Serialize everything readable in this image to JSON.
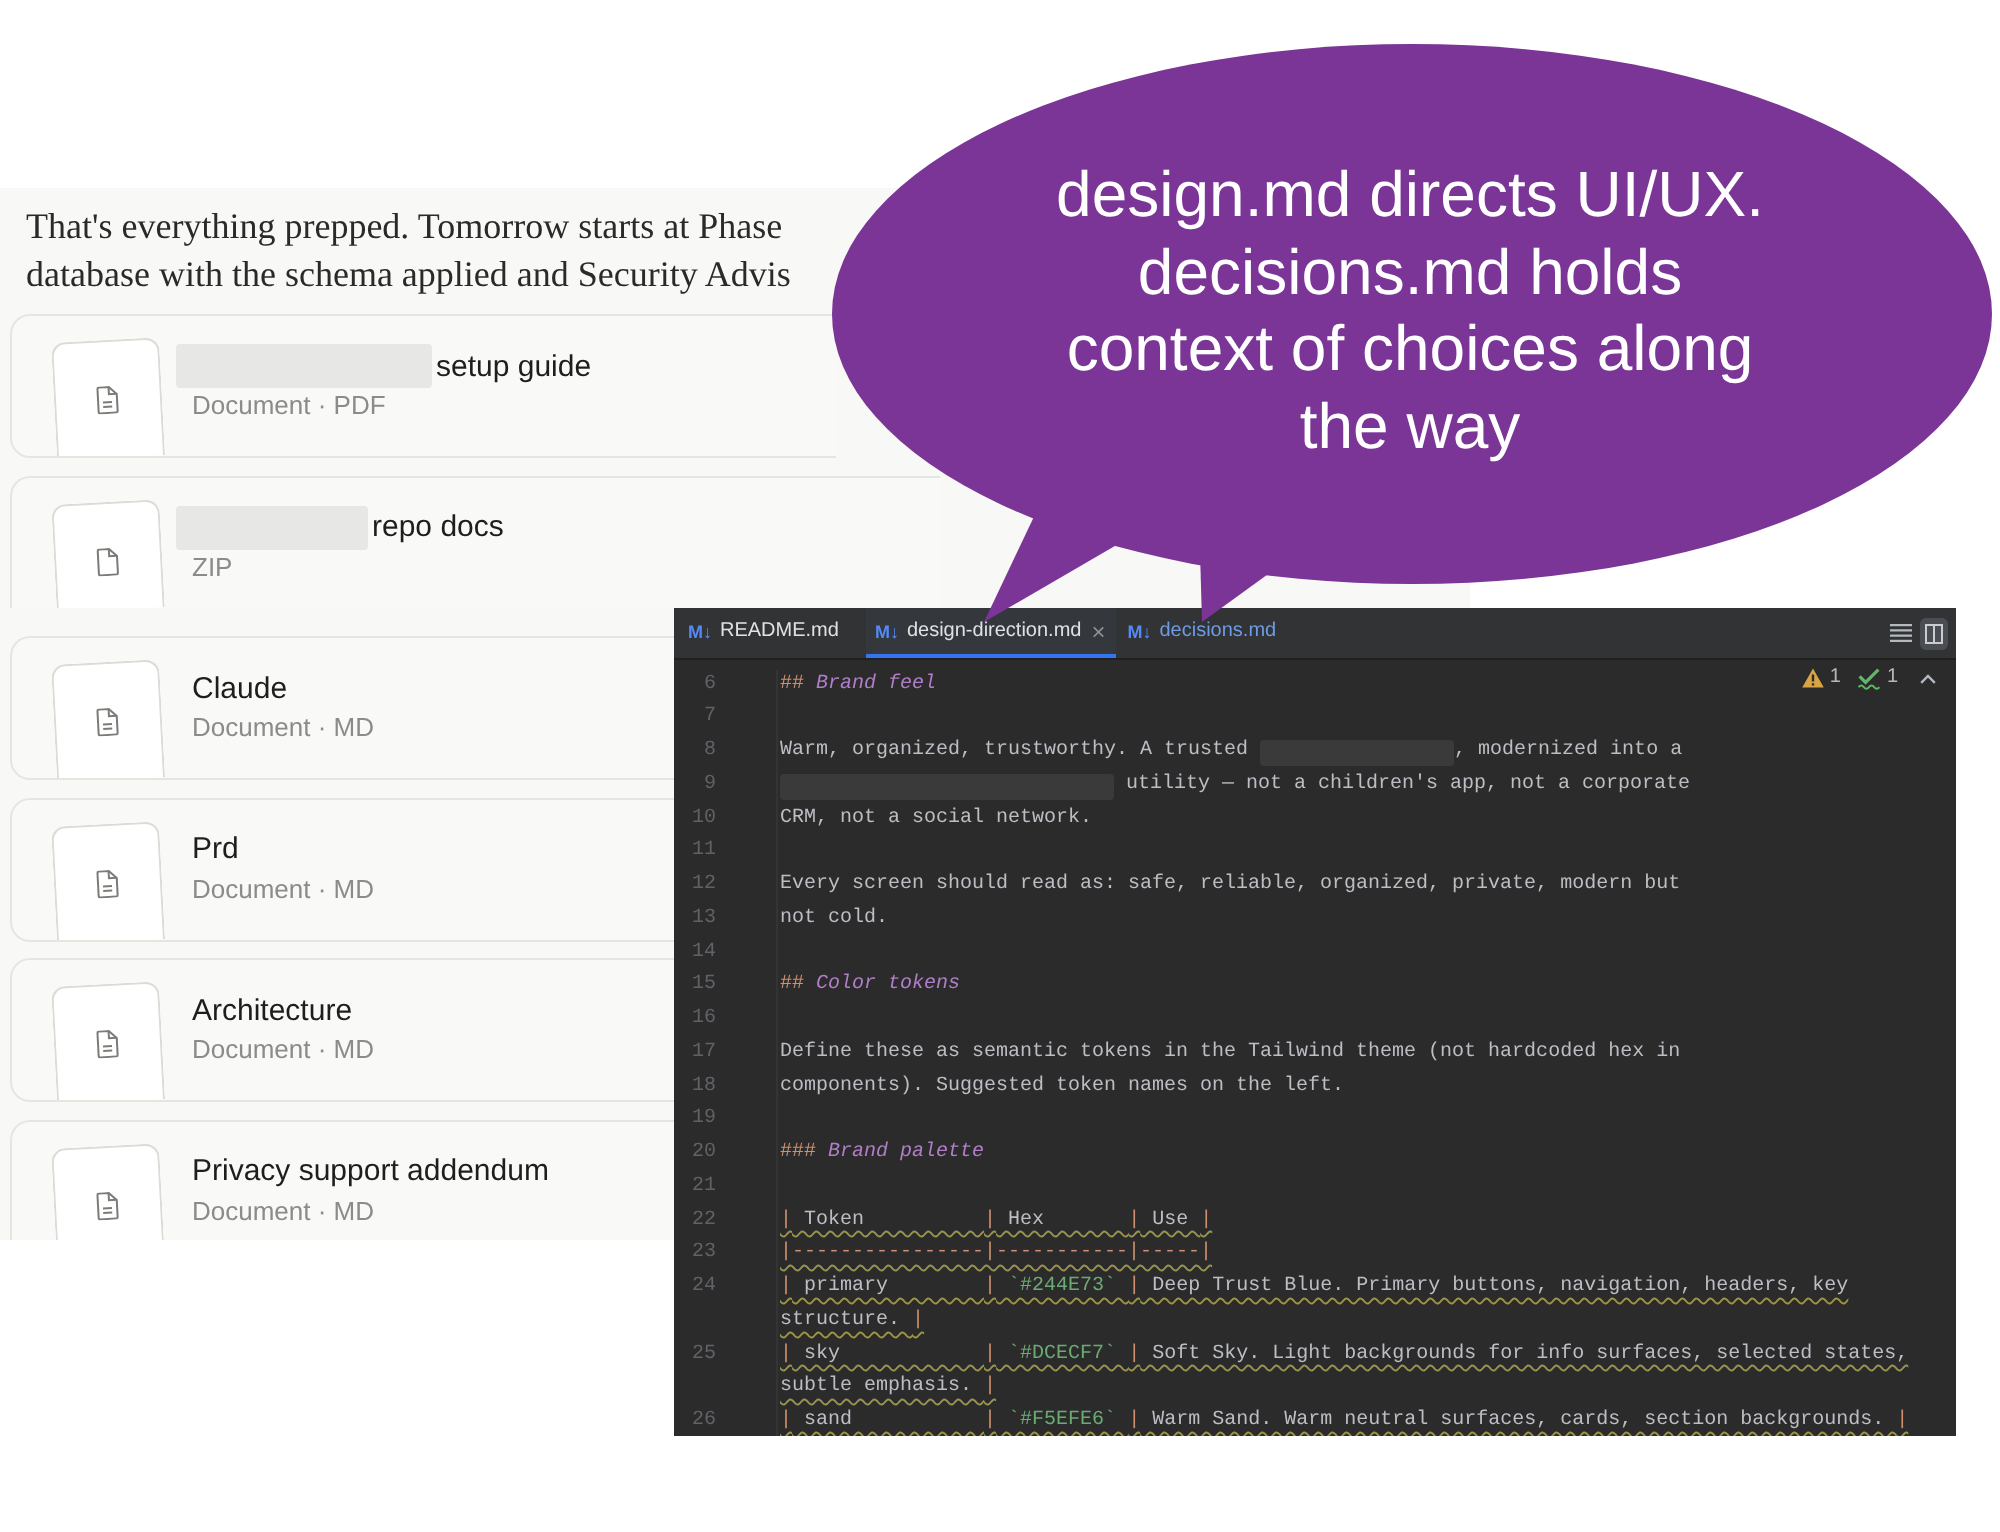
{
  "message": {
    "lines": [
      "That's everything prepped. Tomorrow starts at Phase",
      "database with the schema applied and Security Advis"
    ]
  },
  "files": [
    {
      "kind": "document",
      "redacted": true,
      "title": "setup guide",
      "subtitle": "Document · PDF"
    },
    {
      "kind": "archive",
      "redacted": true,
      "title": "repo docs",
      "subtitle": "ZIP"
    },
    {
      "kind": "document",
      "redacted": false,
      "title": "Claude",
      "subtitle": "Document · MD"
    },
    {
      "kind": "document",
      "redacted": false,
      "title": "Prd",
      "subtitle": "Document · MD"
    },
    {
      "kind": "document",
      "redacted": false,
      "title": "Architecture",
      "subtitle": "Document · MD"
    },
    {
      "kind": "document",
      "redacted": false,
      "title": "Privacy support addendum",
      "subtitle": "Document · MD"
    }
  ],
  "callout": {
    "text": "design.md directs UI/UX. decisions.md holds context of choices along the way"
  },
  "editor": {
    "tabs": [
      {
        "badge": "M↓",
        "label": "README.md",
        "selected": false,
        "modified": false
      },
      {
        "badge": "M↓",
        "label": "design-direction.md",
        "close": "×",
        "selected": true,
        "modified": false
      },
      {
        "badge": "M↓",
        "label": "decisions.md",
        "selected": false,
        "modified": true
      }
    ],
    "inspections": {
      "warnings": "1",
      "typos": "1"
    },
    "rows": [
      {
        "number": "6",
        "flagged": false,
        "segments": [
          {
            "kind": "marker",
            "text": "##"
          },
          {
            "kind": "heading",
            "text": " Brand feel"
          }
        ]
      },
      {
        "number": "7"
      },
      {
        "number": "8",
        "flagged": false,
        "segments": [
          {
            "kind": "text",
            "text": "Warm, organized, trustworthy. A trusted "
          },
          {
            "kind": "redacted"
          },
          {
            "kind": "text",
            "text": ", modernized into a"
          }
        ]
      },
      {
        "number": "9",
        "flagged": false,
        "segments": [
          {
            "kind": "redacted"
          },
          {
            "kind": "text",
            "text": " utility — not a children's app, not a corporate"
          }
        ]
      },
      {
        "number": "10",
        "flagged": false,
        "segments": [
          {
            "kind": "text",
            "text": "CRM, not a social network."
          }
        ]
      },
      {
        "number": "11"
      },
      {
        "number": "12",
        "flagged": false,
        "segments": [
          {
            "kind": "text",
            "text": "Every screen should read as: safe, reliable, organized, private, modern but"
          }
        ]
      },
      {
        "number": "13",
        "flagged": false,
        "segments": [
          {
            "kind": "text",
            "text": "not cold."
          }
        ]
      },
      {
        "number": "14"
      },
      {
        "number": "15",
        "flagged": false,
        "segments": [
          {
            "kind": "marker",
            "text": "##"
          },
          {
            "kind": "heading",
            "text": " Color tokens"
          }
        ]
      },
      {
        "number": "16"
      },
      {
        "number": "17",
        "flagged": false,
        "segments": [
          {
            "kind": "text",
            "text": "Define these as semantic tokens in the Tailwind theme (not hardcoded hex in"
          }
        ]
      },
      {
        "number": "18",
        "flagged": false,
        "segments": [
          {
            "kind": "text",
            "text": "components). Suggested token names on the left."
          }
        ]
      },
      {
        "number": "19"
      },
      {
        "number": "20",
        "flagged": false,
        "segments": [
          {
            "kind": "marker",
            "text": "###"
          },
          {
            "kind": "heading",
            "text": " Brand palette"
          }
        ]
      },
      {
        "number": "21"
      },
      {
        "number": "22",
        "flagged": true,
        "segments": [
          {
            "kind": "marker",
            "text": "|"
          },
          {
            "kind": "text",
            "text": " Token          "
          },
          {
            "kind": "marker",
            "text": "|"
          },
          {
            "kind": "text",
            "text": " Hex       "
          },
          {
            "kind": "marker",
            "text": "|"
          },
          {
            "kind": "text",
            "text": " Use "
          },
          {
            "kind": "marker",
            "text": "|"
          }
        ]
      },
      {
        "number": "23",
        "flagged": true,
        "segments": [
          {
            "kind": "marker",
            "text": "|----------------|-----------|-----|"
          }
        ]
      },
      {
        "number": "24",
        "flagged": true,
        "segments": [
          {
            "kind": "marker",
            "text": "|"
          },
          {
            "kind": "text",
            "text": " primary        "
          },
          {
            "kind": "marker",
            "text": "|"
          },
          {
            "kind": "code",
            "text": " `#244E73` "
          },
          {
            "kind": "marker",
            "text": "|"
          },
          {
            "kind": "text",
            "text": " Deep Trust Blue. Primary buttons, navigation, headers, key"
          }
        ]
      },
      {
        "flagged": true,
        "segments": [
          {
            "kind": "text",
            "text": "structure. "
          },
          {
            "kind": "marker",
            "text": "|"
          }
        ]
      },
      {
        "number": "25",
        "flagged": true,
        "segments": [
          {
            "kind": "marker",
            "text": "|"
          },
          {
            "kind": "text",
            "text": " sky            "
          },
          {
            "kind": "marker",
            "text": "|"
          },
          {
            "kind": "code",
            "text": " `#DCECF7` "
          },
          {
            "kind": "marker",
            "text": "|"
          },
          {
            "kind": "text",
            "text": " Soft Sky. Light backgrounds for info surfaces, selected states,"
          }
        ]
      },
      {
        "flagged": true,
        "segments": [
          {
            "kind": "text",
            "text": "subtle emphasis. "
          },
          {
            "kind": "marker",
            "text": "|"
          }
        ]
      },
      {
        "number": "26",
        "flagged": true,
        "segments": [
          {
            "kind": "marker",
            "text": "|"
          },
          {
            "kind": "text",
            "text": " sand           "
          },
          {
            "kind": "marker",
            "text": "|"
          },
          {
            "kind": "code",
            "text": " `#F5EFE6` "
          },
          {
            "kind": "marker",
            "text": "|"
          },
          {
            "kind": "text",
            "text": " Warm Sand. Warm neutral surfaces, cards, section backgrounds. "
          },
          {
            "kind": "marker",
            "text": "|"
          }
        ]
      }
    ]
  }
}
